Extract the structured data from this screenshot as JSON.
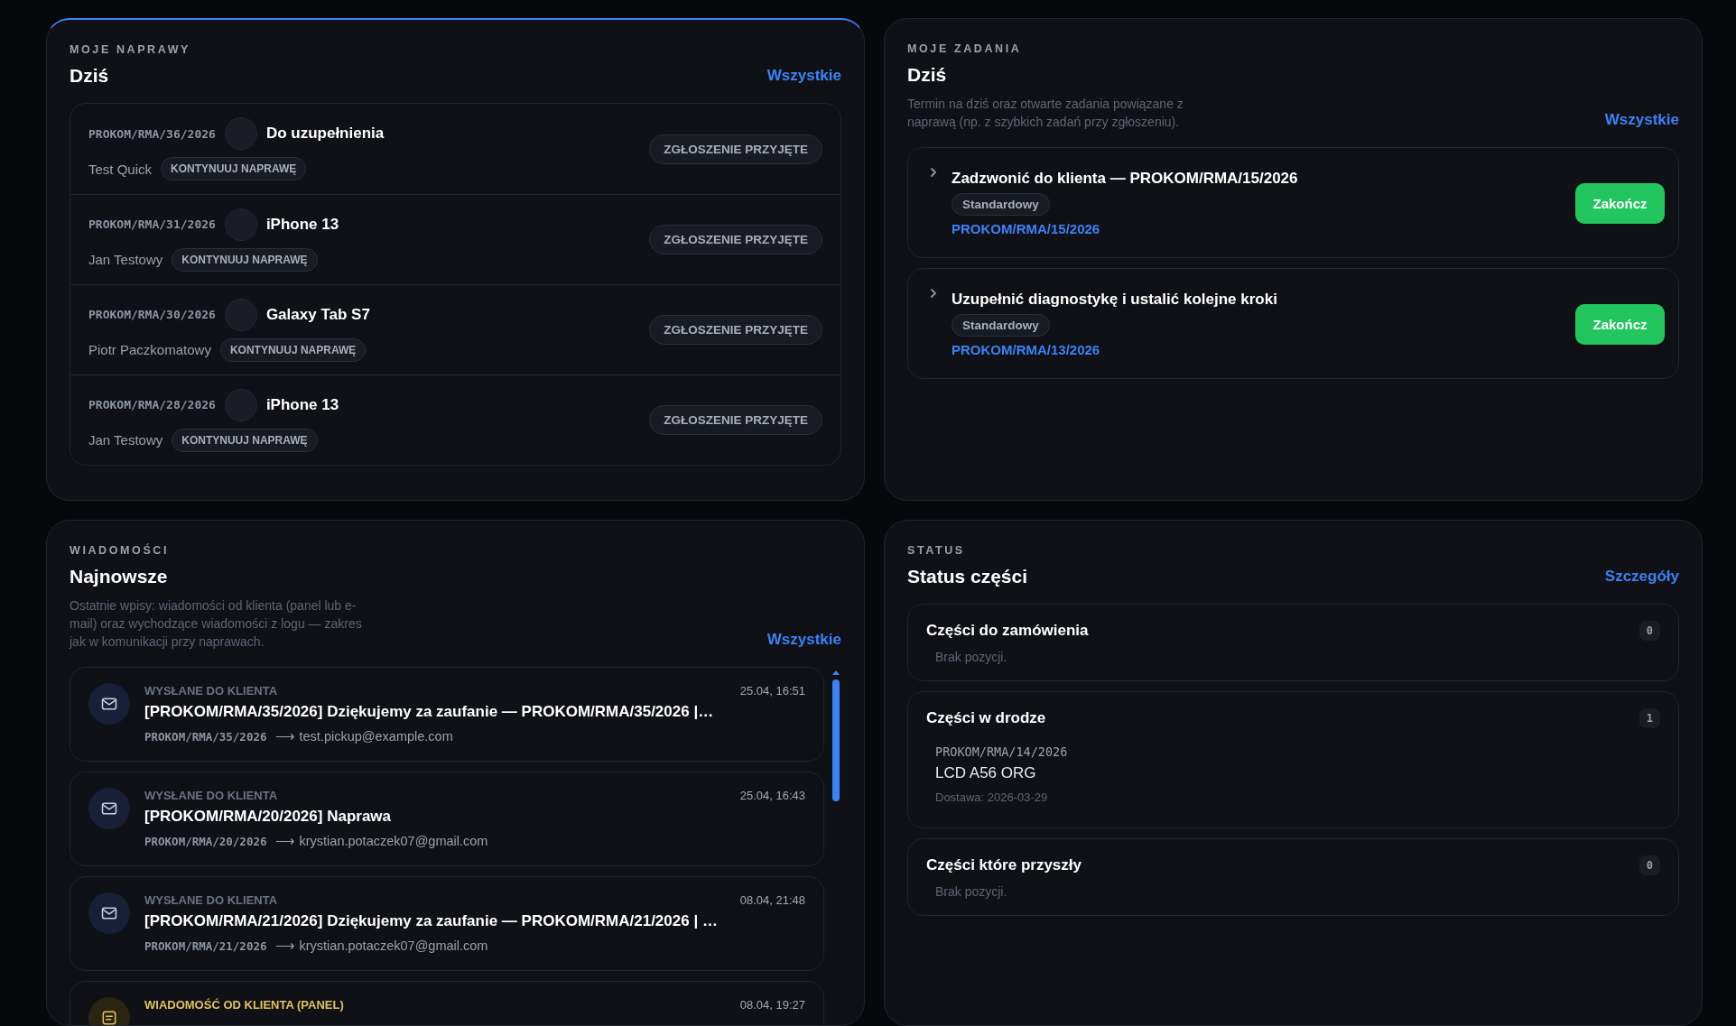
{
  "repairs": {
    "eyebrow": "MOJE NAPRAWY",
    "title": "Dziś",
    "link": "Wszystkie",
    "highlighted": true,
    "rows": [
      {
        "code": "PROKOM/RMA/36/2026",
        "device": "Do uzupełnienia",
        "client": "Test Quick",
        "action": "KONTYNUUJ NAPRAWĘ",
        "status": "ZGŁOSZENIE PRZYJĘTE"
      },
      {
        "code": "PROKOM/RMA/31/2026",
        "device": "iPhone 13",
        "client": "Jan Testowy",
        "action": "KONTYNUUJ NAPRAWĘ",
        "status": "ZGŁOSZENIE PRZYJĘTE"
      },
      {
        "code": "PROKOM/RMA/30/2026",
        "device": "Galaxy Tab S7",
        "client": "Piotr Paczkomatowy",
        "action": "KONTYNUUJ NAPRAWĘ",
        "status": "ZGŁOSZENIE PRZYJĘTE"
      },
      {
        "code": "PROKOM/RMA/28/2026",
        "device": "iPhone 13",
        "client": "Jan Testowy",
        "action": "KONTYNUUJ NAPRAWĘ",
        "status": "ZGŁOSZENIE PRZYJĘTE"
      }
    ]
  },
  "tasks": {
    "eyebrow": "MOJE ZADANIA",
    "title": "Dziś",
    "description": "Termin na dziś oraz otwarte zadania powiązane z naprawą (np. z szybkich zadań przy zgłoszeniu).",
    "link": "Wszystkie",
    "highlighted": false,
    "items": [
      {
        "title": "Zadzwonić do klienta — PROKOM/RMA/15/2026",
        "priority": "Standardowy",
        "repair": "PROKOM/RMA/15/2026",
        "button": "Zakończ",
        "expanded": false
      },
      {
        "title": "Uzupełnić diagnostykę i ustalić kolejne kroki",
        "priority": "Standardowy",
        "repair": "PROKOM/RMA/13/2026",
        "button": "Zakończ",
        "expanded": false
      }
    ]
  },
  "messages": {
    "eyebrow": "WIADOMOŚCI",
    "title": "Najnowsze",
    "description": "Ostatnie wpisy: wiadomości od klienta (panel lub e-mail) oraz wychodzące wiadomości z logu — zakres jak w komunikacji przy naprawach.",
    "link": "Wszystkie",
    "highlighted": false,
    "items": [
      {
        "kind": "outgoing",
        "label": "WYSŁANE DO KLIENTA",
        "date": "25.04, 16:51",
        "subject": "[PROKOM/RMA/35/2026] Dziękujemy za zaufanie — PROKOM/RMA/35/2026 |…",
        "code": "PROKOM/RMA/35/2026",
        "recipient": "⟶ test.pickup@example.com"
      },
      {
        "kind": "outgoing",
        "label": "WYSŁANE DO KLIENTA",
        "date": "25.04, 16:43",
        "subject": "[PROKOM/RMA/20/2026] Naprawa",
        "code": "PROKOM/RMA/20/2026",
        "recipient": "⟶ krystian.potaczek07@gmail.com"
      },
      {
        "kind": "outgoing",
        "label": "WYSŁANE DO KLIENTA",
        "date": "08.04, 21:48",
        "subject": "[PROKOM/RMA/21/2026] Dziękujemy za zaufanie — PROKOM/RMA/21/2026 | …",
        "code": "PROKOM/RMA/21/2026",
        "recipient": "⟶ krystian.potaczek07@gmail.com"
      },
      {
        "kind": "incoming",
        "label": "WIADOMOŚĆ OD KLIENTA (PANEL)",
        "date": "08.04, 19:27"
      }
    ]
  },
  "parts": {
    "eyebrow": "STATUS",
    "title": "Status części",
    "link": "Szczegóły",
    "highlighted": false,
    "groups": [
      {
        "title": "Części do zamówienia",
        "count": "0",
        "empty": "Brak pozycji."
      },
      {
        "title": "Części w drodze",
        "count": "1",
        "items": [
          {
            "code": "PROKOM/RMA/14/2026",
            "name": "LCD A56 ORG",
            "delivery": "Dostawa: 2026-03-29"
          }
        ]
      },
      {
        "title": "Części które przyszły",
        "count": "0",
        "empty": "Brak pozycji."
      }
    ]
  }
}
